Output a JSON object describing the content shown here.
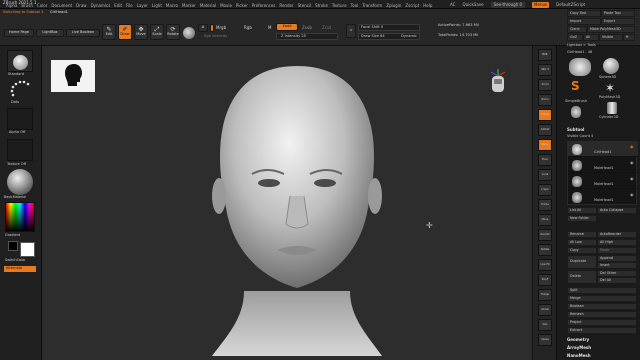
{
  "app": {
    "title": "ZBrush 2021.5.1"
  },
  "menu": [
    "Alpha",
    "Brush",
    "Color",
    "Document",
    "Draw",
    "Dynamics",
    "Edit",
    "File",
    "Layer",
    "Light",
    "Macro",
    "Marker",
    "Material",
    "Movie",
    "Picker",
    "Preferences",
    "Render",
    "Stencil",
    "Stroke",
    "Texture",
    "Tool",
    "Transform",
    "Zplugin",
    "Zscript",
    "Help"
  ],
  "menu_right": {
    "ac": "AC",
    "quicksave": "QuickSave",
    "seethrough": "See-through 0",
    "menus": "Menus",
    "default_zscript": "DefaultZScript"
  },
  "status": {
    "switching": "Switching to Subtool 3",
    "subtool_name": "GirlHead1"
  },
  "toolbar": {
    "home_page": "Home Page",
    "lightbox": "LightBox",
    "live_boolean": "Live Boolean",
    "edit": "Edit",
    "draw": "Draw",
    "move": "Move",
    "scale": "Scale",
    "rotate": "Rotate",
    "a": "A",
    "mrgb": "Mrgb",
    "rgb": "Rgb",
    "m": "M",
    "rgb_intensity": "Rgb Intensity",
    "zadd": "Zadd",
    "zsub": "Zsub",
    "zcut": "Zcut",
    "z_intensity": "Z Intensity 25",
    "focal_shift": "Focal Shift 0",
    "draw_size": "Draw Size 64",
    "dynamic": "Dynamic",
    "active_points": "ActivePoints: 7.663 Mil",
    "total_points": "TotalPoints: 14.703 Mil"
  },
  "left_shelf": {
    "standard": "Standard",
    "dots": "Dots",
    "alpha_off": "Alpha Off",
    "texture_off": "Texture Off",
    "basic_material": "BasicMaterial",
    "gradient": "Gradient",
    "switch_color": "SwitchColor",
    "alternate": "Alternate"
  },
  "tray_strip": [
    "BPR",
    "SPix 3",
    "Scroll",
    "Zoom",
    "Actual",
    "AAHalf",
    "Persp",
    "Floor",
    "Local",
    "L.Sym",
    "Frame",
    "Move",
    "ZoomD",
    "Rotate",
    "Line Fill",
    "PolyF",
    "Transp",
    "Ghost",
    "Solo",
    "Xpose"
  ],
  "right_tray": {
    "copy_tool": "Copy Tool",
    "paste_tool": "Paste Tool",
    "import": "Import",
    "export": "Export",
    "clone": "Clone",
    "make_polymesh": "Make PolyMesh3D",
    "goz": "GoZ",
    "all": "All",
    "visible": "Visible",
    "r": "R",
    "lightbox_tools": "Lightbox > Tools",
    "girlhead_count": "GirlHead1 . 48",
    "tools": [
      "GirlHead1",
      "Sphere3D",
      "SimpleBrush",
      "PolyMesh3D",
      "Cylinder3D"
    ],
    "subtool_title": "Subtool",
    "visible_count": "Visible Count 4",
    "subtools": [
      "GirlHead1",
      "MaleHead1",
      "MaleHead1",
      "MaleHead1"
    ],
    "list_all": "List All",
    "auto_collapse": "Auto Collapse",
    "new_folder": "New Folder",
    "rename": "Rename",
    "autoreorder": "AutoReorder",
    "all_low": "All Low",
    "all_high": "All High",
    "copy": "Copy",
    "paste": "Paste",
    "duplicate": "Duplicate",
    "append": "Append",
    "insert": "Insert",
    "delete": "Delete",
    "del_other": "Del Other",
    "del_all": "Del All",
    "split": "Split",
    "merge": "Merge",
    "boolean": "Boolean",
    "remesh": "Remesh",
    "project": "Project",
    "extract": "Extract",
    "geometry": "Geometry",
    "arraymesh": "ArrayMesh",
    "nanomesh": "NanoMesh"
  },
  "colors": {
    "accent": "#e8791c",
    "panel": "#202020",
    "viewport": "#2d2d2d"
  }
}
